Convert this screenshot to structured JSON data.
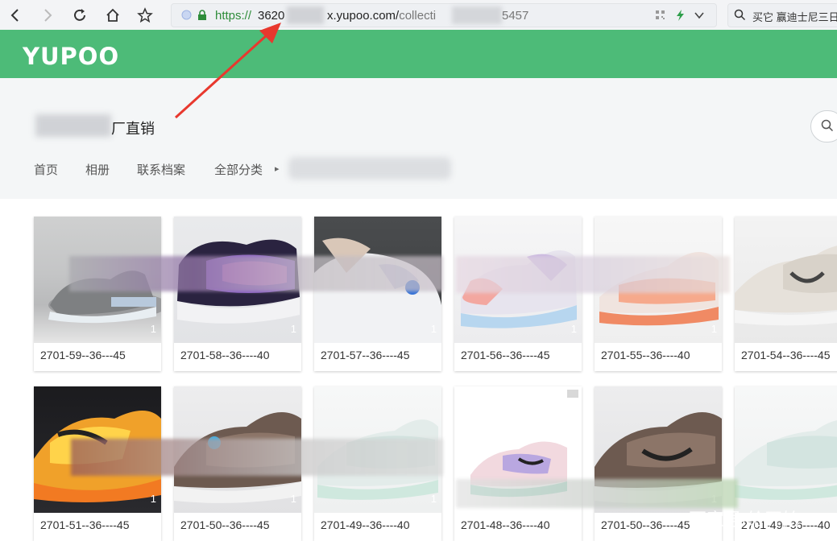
{
  "browser": {
    "url_protocol": "https://",
    "url_host_start": "3620",
    "url_mid": "x.yupoo.com/",
    "url_path": "collecti",
    "url_tail": "5457",
    "search_text": "买它   赢迪士尼三日"
  },
  "site": {
    "logo": "YUPOO",
    "store_title_suffix": "厂直销",
    "nav": [
      "首页",
      "相册",
      "联系档案",
      "全部分类"
    ],
    "breadcrumb_sep": "▸"
  },
  "grid": {
    "items": [
      {
        "caption": "2701-59--36---45",
        "count": "1"
      },
      {
        "caption": "2701-58--36----40",
        "count": "1"
      },
      {
        "caption": "2701-57--36----45",
        "count": "1"
      },
      {
        "caption": "2701-56--36----45",
        "count": "1"
      },
      {
        "caption": "2701-55--36----40",
        "count": "1"
      },
      {
        "caption": "2701-54--36----45",
        "count": "1"
      },
      {
        "caption": "2701-51--36----45",
        "count": "1"
      },
      {
        "caption": "2701-50--36----45",
        "count": "1"
      },
      {
        "caption": "2701-49--36----40",
        "count": "1"
      },
      {
        "caption": "2701-48--36----40",
        "count": "1"
      },
      {
        "caption": "2701-50--36----45",
        "count": "1"
      },
      {
        "caption": "2701-49--36----40",
        "count": "1"
      }
    ]
  },
  "overlay": {
    "watermark": "百家号/给开始"
  },
  "colors": {
    "brand_green": "#4dbb78",
    "annotation_red": "#e8382e"
  }
}
